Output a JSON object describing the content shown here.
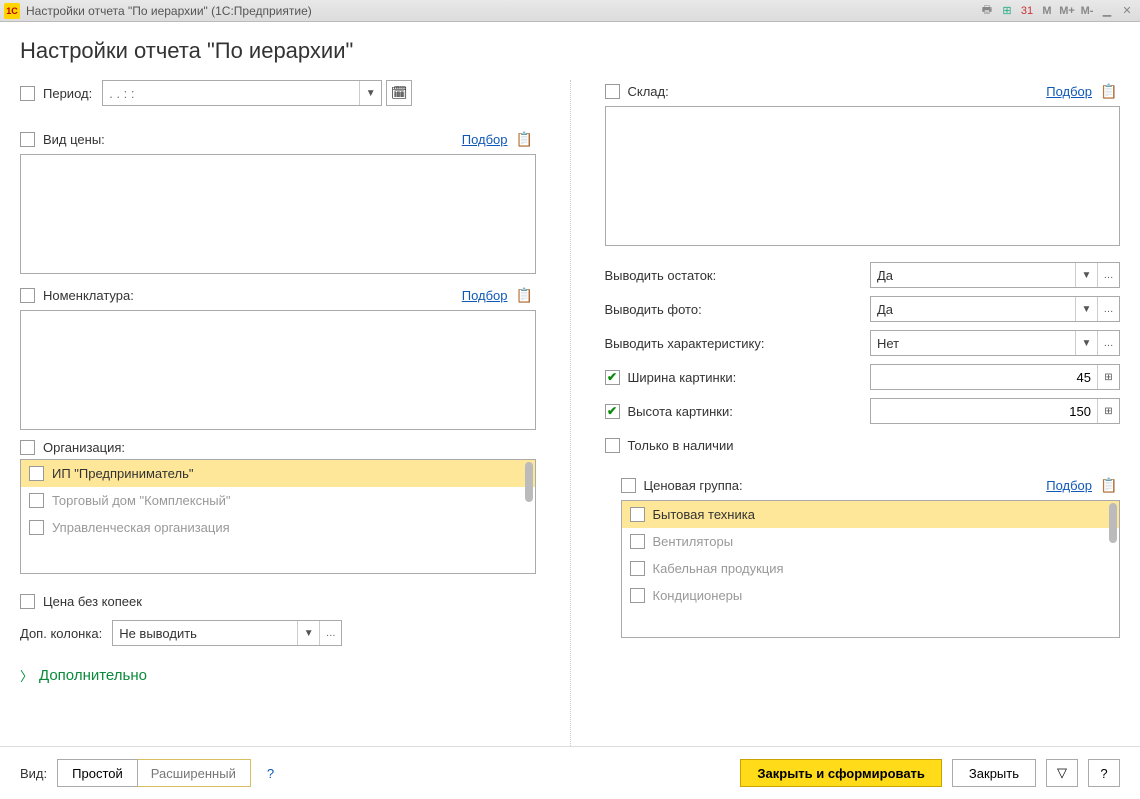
{
  "window": {
    "title": "Настройки отчета \"По иерархии\"  (1С:Предприятие)"
  },
  "page": {
    "title": "Настройки отчета \"По иерархии\""
  },
  "left": {
    "period": {
      "label": "Период:",
      "value": " .  .     :  :"
    },
    "price_type": {
      "label": "Вид цены:",
      "select": "Подбор"
    },
    "nomenclature": {
      "label": "Номенклатура:",
      "select": "Подбор"
    },
    "org": {
      "label": "Организация:",
      "items": [
        "ИП \"Предприниматель\"",
        "Торговый дом \"Комплексный\"",
        "Управленческая организация"
      ]
    },
    "no_kopeks": "Цена без копеек",
    "extra_col": {
      "label": "Доп. колонка:",
      "value": "Не выводить"
    },
    "more": "Дополнительно",
    "view": {
      "label": "Вид:",
      "simple": "Простой",
      "ext": "Расширенный"
    }
  },
  "right": {
    "warehouse": {
      "label": "Склад:",
      "select": "Подбор"
    },
    "show_stock": {
      "label": "Выводить остаток:",
      "value": "Да"
    },
    "show_photo": {
      "label": "Выводить фото:",
      "value": "Да"
    },
    "show_char": {
      "label": "Выводить характеристику:",
      "value": "Нет"
    },
    "img_w": {
      "label": "Ширина картинки:",
      "value": "45"
    },
    "img_h": {
      "label": "Высота картинки:",
      "value": "150"
    },
    "only_stock": "Только в наличии",
    "price_group": {
      "label": "Ценовая группа:",
      "select": "Подбор",
      "items": [
        "Бытовая техника",
        "Вентиляторы",
        "Кабельная продукция",
        "Кондиционеры"
      ]
    }
  },
  "footer": {
    "close_form": "Закрыть и сформировать",
    "close": "Закрыть"
  },
  "toolbar_m": {
    "m": "M",
    "mp": "M+",
    "mm": "M-"
  }
}
